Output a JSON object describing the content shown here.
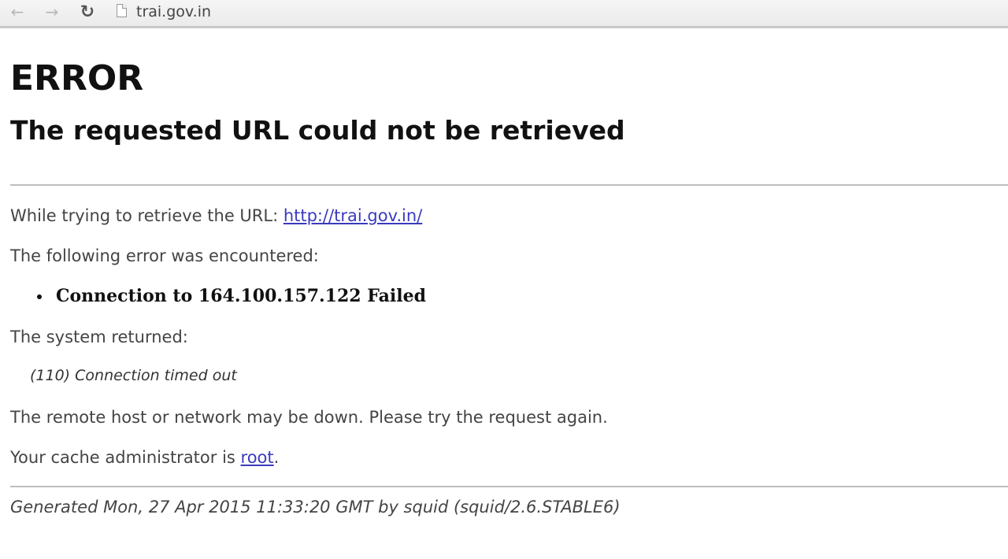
{
  "browser": {
    "address": "trai.gov.in",
    "icons": {
      "back": "back-arrow-icon",
      "forward": "forward-arrow-icon",
      "reload": "reload-icon",
      "page": "page-icon"
    }
  },
  "page": {
    "title": "ERROR",
    "subtitle": "The requested URL could not be retrieved",
    "url_prefix": "While trying to retrieve the URL: ",
    "url_link": "http://trai.gov.in/",
    "following": "The following error was encountered:",
    "error_item": "Connection to 164.100.157.122 Failed",
    "system_returned": "The system returned:",
    "error_code": "(110) Connection timed out",
    "remote_note": "The remote host or network may be down. Please try the request again.",
    "cache_prefix": "Your cache administrator is ",
    "cache_link": "root",
    "cache_suffix": ".",
    "generated": "Generated Mon, 27 Apr 2015 11:33:20 GMT by squid (squid/2.6.STABLE6)"
  }
}
